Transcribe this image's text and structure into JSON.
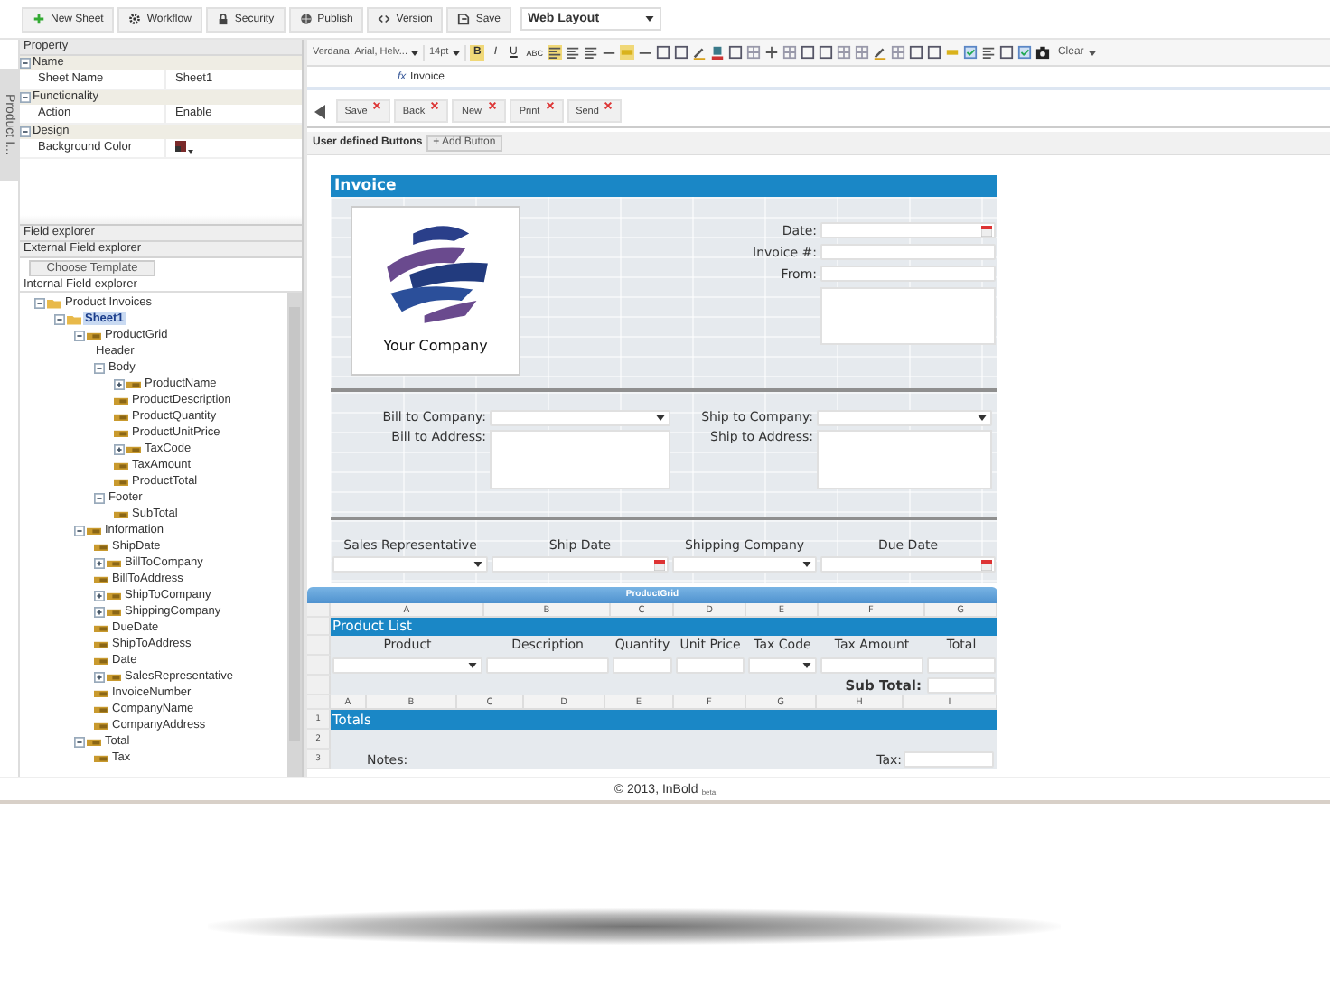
{
  "toolbar": {
    "buttons": [
      "New Sheet",
      "Workflow",
      "Security",
      "Publish",
      "Version",
      "Save"
    ],
    "layout_select": "Web Layout"
  },
  "side_tab": "Product I...",
  "property": {
    "title": "Property",
    "groups": [
      {
        "name": "Name",
        "expanded": true,
        "rows": [
          {
            "label": "Sheet Name",
            "kind": "text",
            "value": "Sheet1"
          }
        ]
      },
      {
        "name": "Functionality",
        "expanded": true,
        "rows": [
          {
            "label": "Action",
            "kind": "text",
            "value": "Enable"
          }
        ]
      },
      {
        "name": "Design",
        "expanded": true,
        "rows": [
          {
            "label": "Background Color",
            "kind": "color"
          }
        ]
      }
    ]
  },
  "field_explorer": {
    "headers": [
      "Field explorer",
      "External Field explorer"
    ],
    "choose_template": "Choose Template",
    "internal_title": "Internal Field explorer",
    "tree": [
      {
        "label": "Product Invoices",
        "expanded": true,
        "kind": "folder",
        "selected": false,
        "children": [
          {
            "label": "Sheet1",
            "expanded": true,
            "kind": "folder",
            "selected": true,
            "children": [
              {
                "label": "ProductGrid",
                "expanded": true,
                "kind": "field",
                "selected": false,
                "children": [
                  {
                    "label": "Header",
                    "kind": "plain",
                    "selected": false
                  },
                  {
                    "label": "Body",
                    "expanded": true,
                    "kind": "plain",
                    "selected": false,
                    "children": [
                      {
                        "label": "ProductName",
                        "expanded": false,
                        "kind": "field",
                        "selected": false
                      },
                      {
                        "label": "ProductDescription",
                        "kind": "field",
                        "selected": false
                      },
                      {
                        "label": "ProductQuantity",
                        "kind": "field",
                        "selected": false
                      },
                      {
                        "label": "ProductUnitPrice",
                        "kind": "field",
                        "selected": false
                      },
                      {
                        "label": "TaxCode",
                        "expanded": false,
                        "kind": "field",
                        "selected": false
                      },
                      {
                        "label": "TaxAmount",
                        "kind": "field",
                        "selected": false
                      },
                      {
                        "label": "ProductTotal",
                        "kind": "field",
                        "selected": false
                      }
                    ]
                  },
                  {
                    "label": "Footer",
                    "expanded": true,
                    "kind": "plain",
                    "selected": false,
                    "children": [
                      {
                        "label": "SubTotal",
                        "kind": "field",
                        "selected": false
                      }
                    ]
                  }
                ]
              },
              {
                "label": "Information",
                "expanded": true,
                "kind": "field",
                "selected": false,
                "children": [
                  {
                    "label": "ShipDate",
                    "kind": "field",
                    "selected": false
                  },
                  {
                    "label": "BillToCompany",
                    "expanded": false,
                    "kind": "field",
                    "selected": false
                  },
                  {
                    "label": "BillToAddress",
                    "kind": "field",
                    "selected": false
                  },
                  {
                    "label": "ShipToCompany",
                    "expanded": false,
                    "kind": "field",
                    "selected": false
                  },
                  {
                    "label": "ShippingCompany",
                    "expanded": false,
                    "kind": "field",
                    "selected": false
                  },
                  {
                    "label": "DueDate",
                    "kind": "field",
                    "selected": false
                  },
                  {
                    "label": "ShipToAddress",
                    "kind": "field",
                    "selected": false
                  },
                  {
                    "label": "Date",
                    "kind": "field",
                    "selected": false
                  },
                  {
                    "label": "SalesRepresentative",
                    "expanded": false,
                    "kind": "field",
                    "selected": false
                  },
                  {
                    "label": "InvoiceNumber",
                    "kind": "field",
                    "selected": false
                  },
                  {
                    "label": "CompanyName",
                    "kind": "field",
                    "selected": false
                  },
                  {
                    "label": "CompanyAddress",
                    "kind": "field",
                    "selected": false
                  }
                ]
              },
              {
                "label": "Total",
                "expanded": true,
                "kind": "field",
                "selected": false,
                "children": [
                  {
                    "label": "Tax",
                    "kind": "field",
                    "selected": false
                  }
                ]
              }
            ]
          }
        ]
      }
    ]
  },
  "format_toolbar": {
    "font": "Verdana, Arial, Helv...",
    "size": "14pt",
    "styles": [
      "B",
      "I",
      "U",
      "ABC"
    ],
    "clear": "Clear"
  },
  "formula": {
    "label": "fx",
    "value": "Invoice"
  },
  "action_buttons": [
    "Save",
    "Back",
    "New",
    "Print",
    "Send"
  ],
  "user_buttons": {
    "label": "User defined Buttons",
    "add": "+ Add Button"
  },
  "form": {
    "title": "Invoice",
    "logo_caption": "Your Company",
    "header_fields": [
      {
        "label": "Date:",
        "kind": "date"
      },
      {
        "label": "Invoice #:",
        "kind": "text"
      },
      {
        "label": "From:",
        "kind": "text"
      }
    ],
    "bill": [
      {
        "label": "Bill to Company:",
        "kind": "select"
      },
      {
        "label": "Bill to Address:",
        "kind": "textarea"
      }
    ],
    "ship": [
      {
        "label": "Ship to Company:",
        "kind": "select"
      },
      {
        "label": "Ship to Address:",
        "kind": "textarea"
      }
    ],
    "shipping": [
      {
        "label": "Sales Representative",
        "kind": "select"
      },
      {
        "label": "Ship Date",
        "kind": "date"
      },
      {
        "label": "Shipping Company",
        "kind": "select"
      },
      {
        "label": "Due Date",
        "kind": "date"
      }
    ]
  },
  "grid": {
    "title": "ProductGrid",
    "letters": [
      "A",
      "B",
      "C",
      "D",
      "E",
      "F",
      "G"
    ],
    "section_title": "Product List",
    "columns": [
      {
        "label": "Product",
        "kind": "select"
      },
      {
        "label": "Description",
        "kind": "text"
      },
      {
        "label": "Quantity",
        "kind": "text"
      },
      {
        "label": "Unit Price",
        "kind": "text"
      },
      {
        "label": "Tax Code",
        "kind": "select"
      },
      {
        "label": "Tax Amount",
        "kind": "text"
      },
      {
        "label": "Total",
        "kind": "text"
      }
    ],
    "subtotal_label": "Sub Total:"
  },
  "totals": {
    "letters": [
      "A",
      "B",
      "C",
      "D",
      "E",
      "F",
      "G",
      "H",
      "I"
    ],
    "rows": [
      {
        "number": "1",
        "kind": "title",
        "title": "Totals"
      },
      {
        "number": "2",
        "kind": "empty"
      },
      {
        "number": "3",
        "kind": "notes",
        "notes_label": "Notes:",
        "tax_label": "Tax:"
      }
    ]
  },
  "footer": {
    "copyright": "© 2013, InBold",
    "badge": "beta"
  }
}
